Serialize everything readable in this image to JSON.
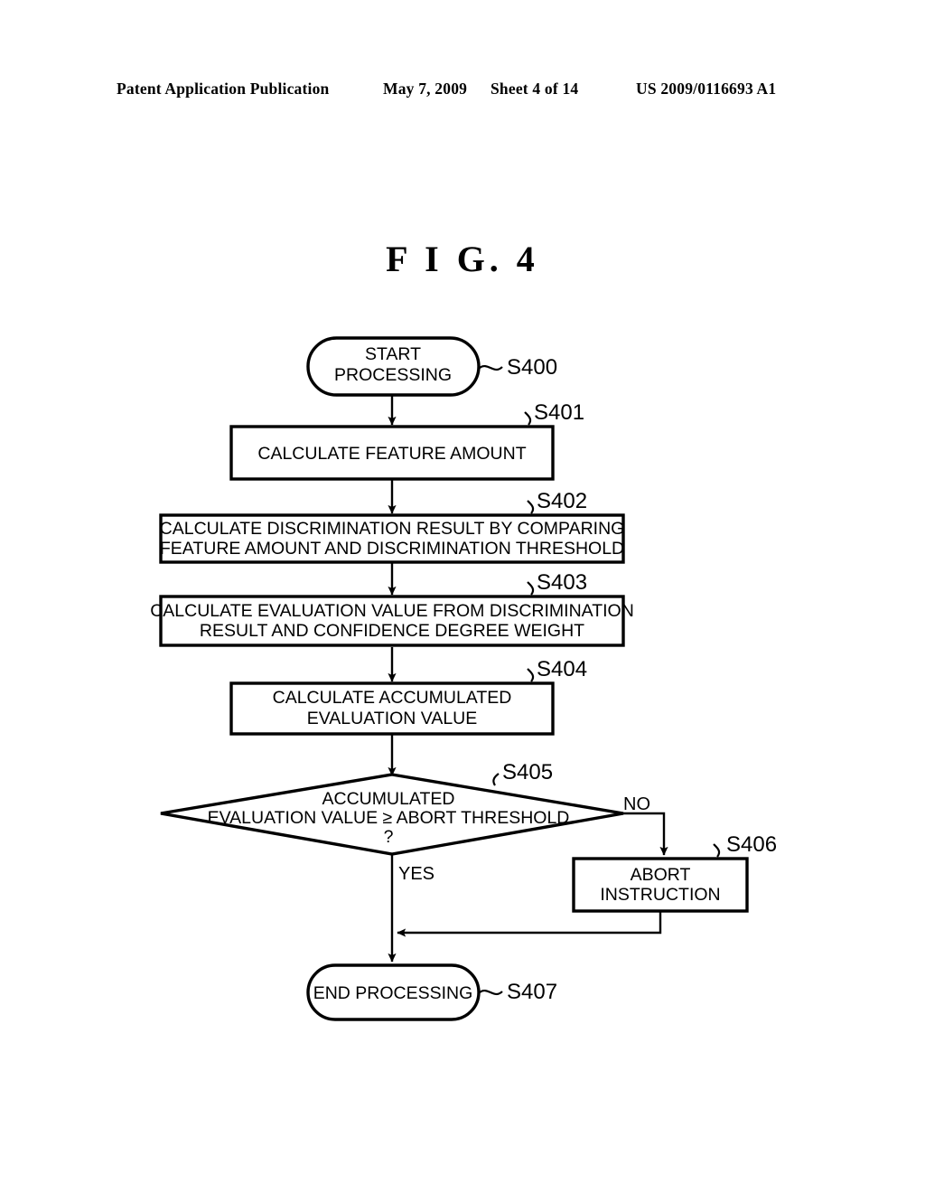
{
  "header": {
    "publication": "Patent Application Publication",
    "date": "May 7, 2009",
    "sheet": "Sheet 4 of 14",
    "number": "US 2009/0116693 A1"
  },
  "figure": {
    "title": "F I G.  4"
  },
  "flowchart": {
    "nodes": [
      {
        "id": "S400",
        "shape": "terminator",
        "label": "S400",
        "lines": [
          "START",
          "PROCESSING"
        ]
      },
      {
        "id": "S401",
        "shape": "process",
        "label": "S401",
        "lines": [
          "CALCULATE FEATURE AMOUNT"
        ]
      },
      {
        "id": "S402",
        "shape": "process",
        "label": "S402",
        "lines": [
          "CALCULATE DISCRIMINATION RESULT BY COMPARING",
          "FEATURE AMOUNT AND DISCRIMINATION THRESHOLD"
        ]
      },
      {
        "id": "S403",
        "shape": "process",
        "label": "S403",
        "lines": [
          "CALCULATE EVALUATION VALUE FROM DISCRIMINATION",
          "RESULT AND CONFIDENCE DEGREE WEIGHT"
        ]
      },
      {
        "id": "S404",
        "shape": "process",
        "label": "S404",
        "lines": [
          "CALCULATE ACCUMULATED",
          "EVALUATION VALUE"
        ]
      },
      {
        "id": "S405",
        "shape": "decision",
        "label": "S405",
        "lines": [
          "ACCUMULATED",
          "EVALUATION VALUE ≥ ABORT THRESHOLD",
          "?"
        ]
      },
      {
        "id": "S406",
        "shape": "process",
        "label": "S406",
        "lines": [
          "ABORT",
          "INSTRUCTION"
        ]
      },
      {
        "id": "S407",
        "shape": "terminator",
        "label": "S407",
        "lines": [
          "END PROCESSING"
        ]
      }
    ],
    "branches": {
      "yes": "YES",
      "no": "NO"
    }
  }
}
